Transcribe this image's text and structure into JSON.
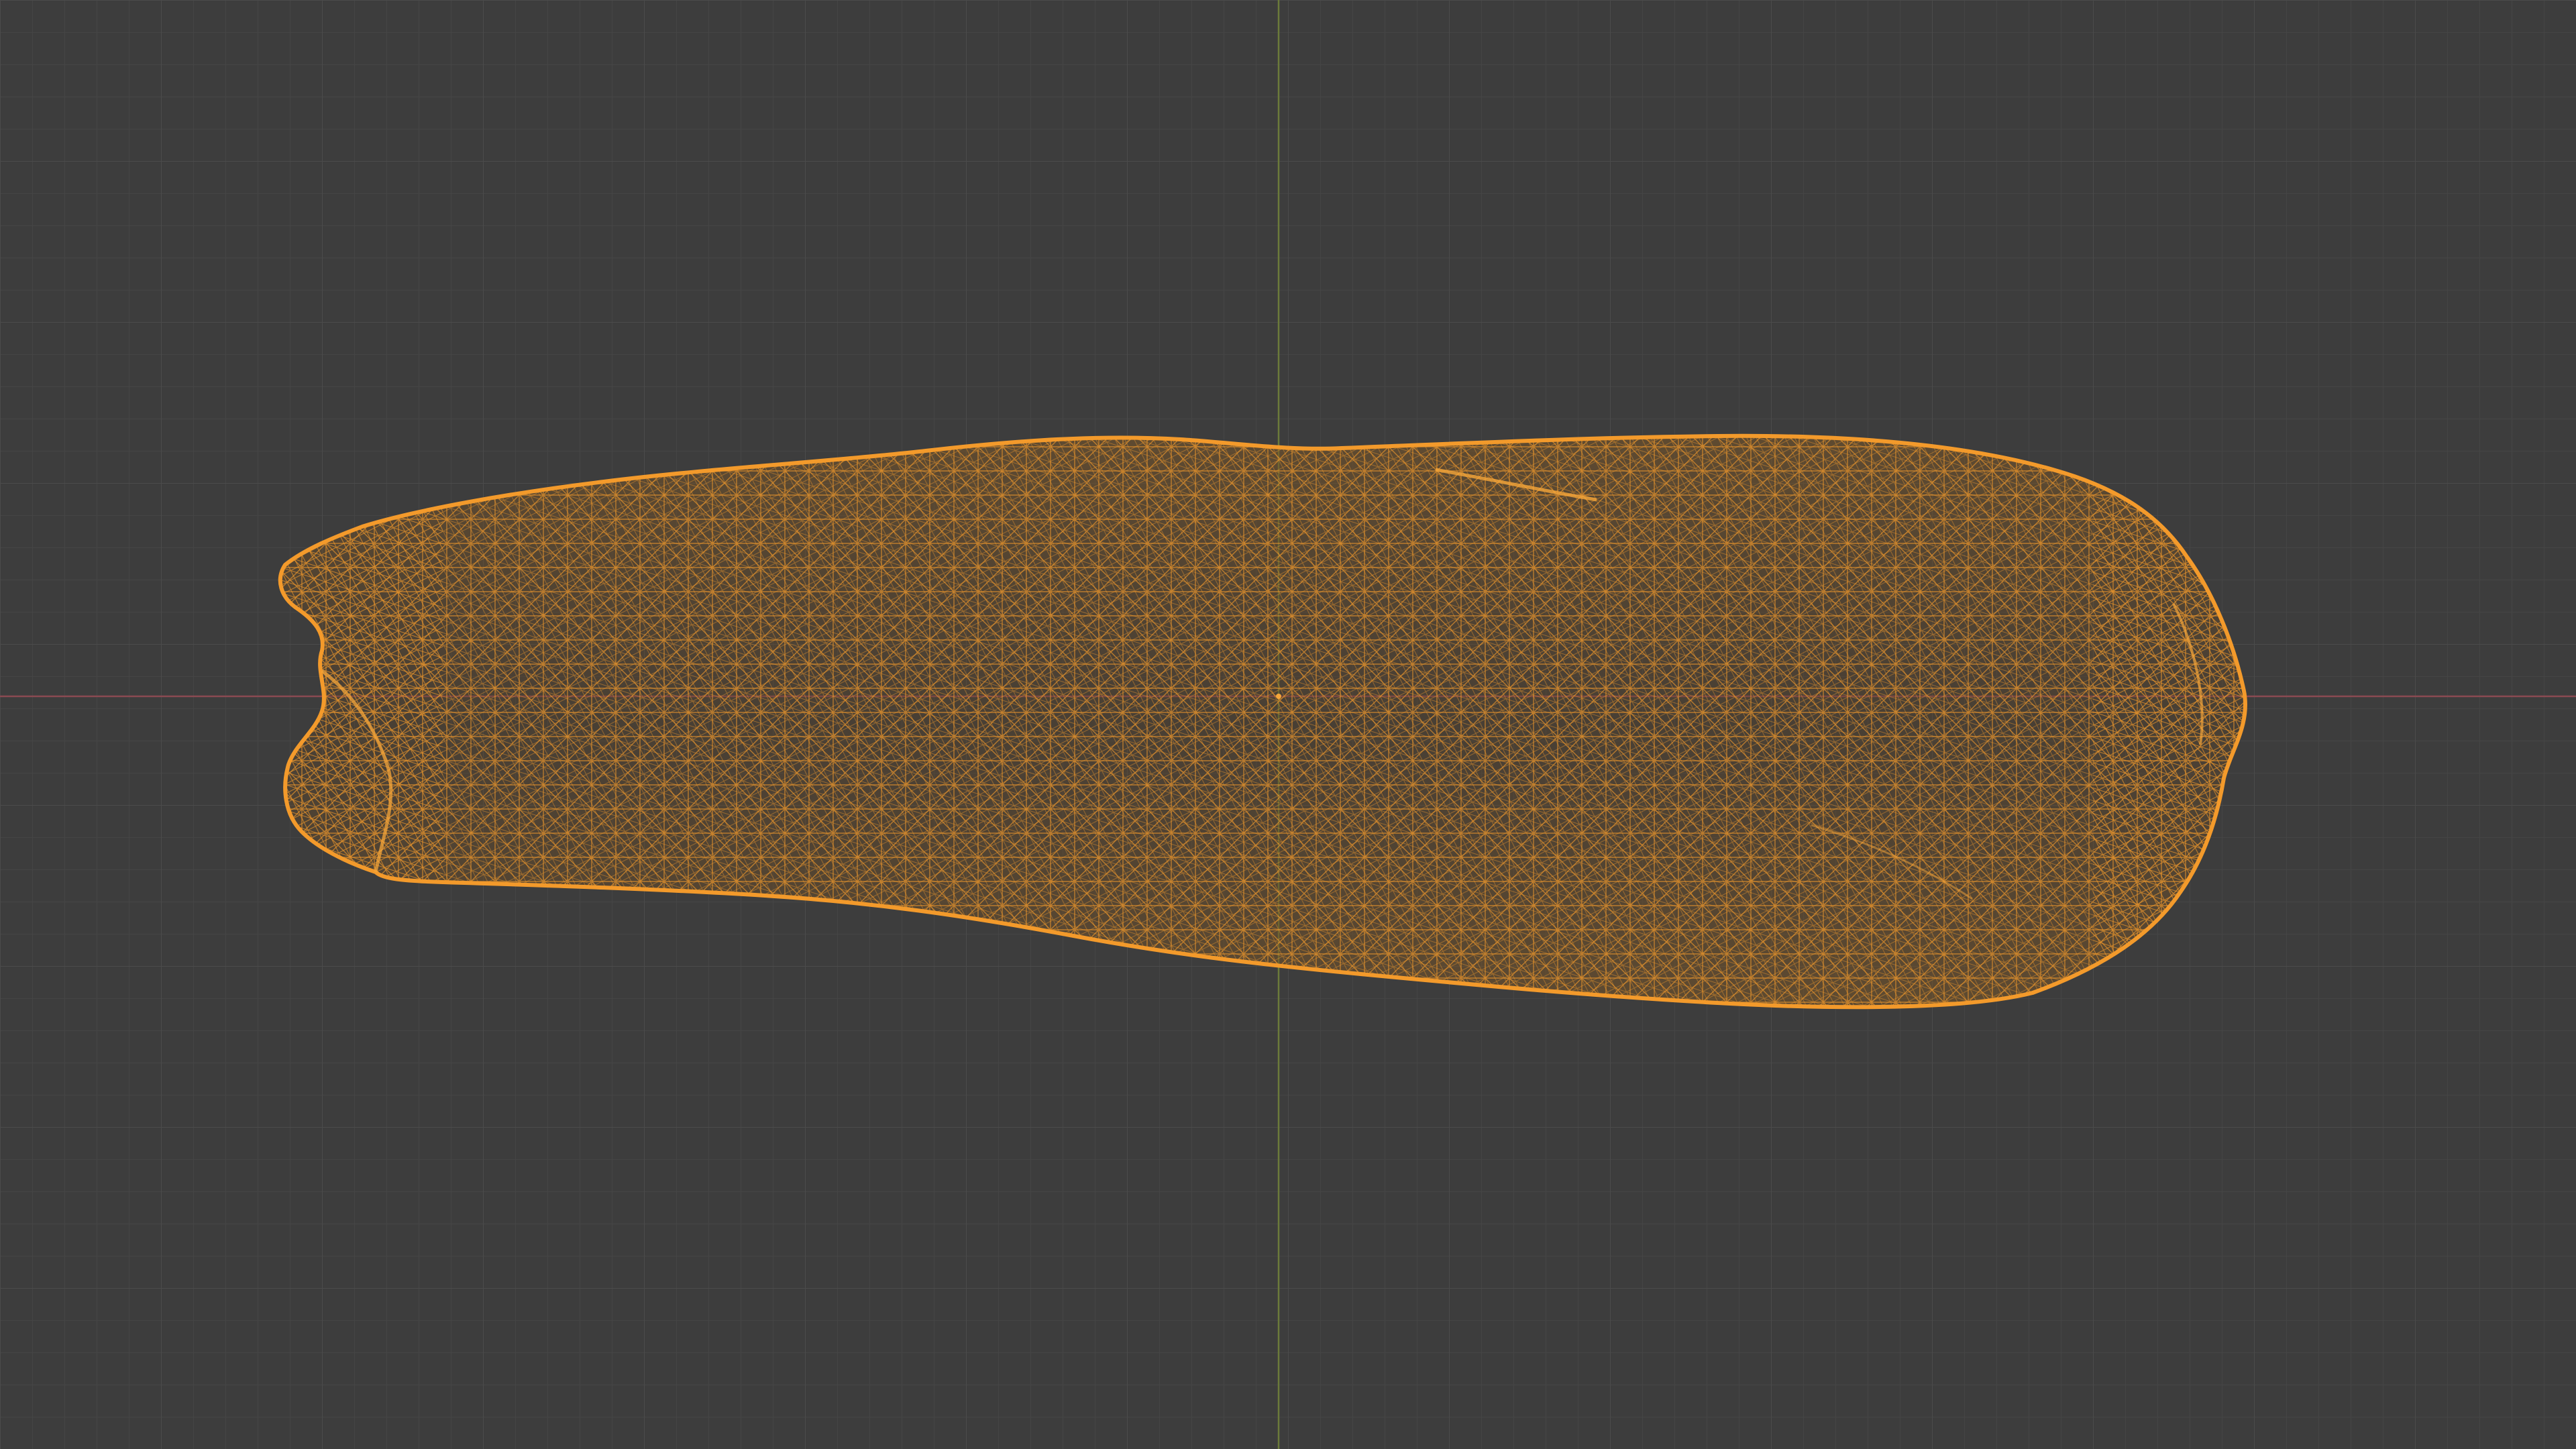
{
  "viewport": {
    "mode": "wireframe",
    "object": {
      "type": "mesh",
      "selected": true
    },
    "grid": true,
    "axes": {
      "x_axis": true,
      "y_axis": true
    }
  },
  "colors": {
    "background": "#3d3d3d",
    "grid_minor": "#444444",
    "grid_major": "#4a4a4a",
    "x_axis": "#8a4a52",
    "y_axis": "#6b7a3a",
    "selection_wire": "#f39a2b",
    "selection_fill": "#6b4a24"
  }
}
